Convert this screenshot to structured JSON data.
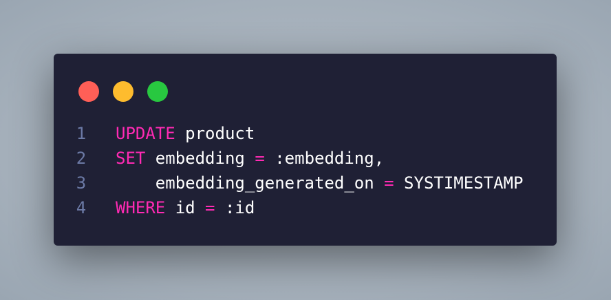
{
  "window_controls": {
    "colors": {
      "close": "#ff5f57",
      "minimize": "#febc2e",
      "maximize": "#28c840"
    }
  },
  "code": {
    "lines": [
      {
        "number": "1",
        "tokens": [
          {
            "t": "UPDATE",
            "k": "kw"
          },
          {
            "t": " product",
            "k": "id"
          }
        ]
      },
      {
        "number": "2",
        "tokens": [
          {
            "t": "SET",
            "k": "kw"
          },
          {
            "t": " embedding ",
            "k": "id"
          },
          {
            "t": "=",
            "k": "op"
          },
          {
            "t": " :embedding,",
            "k": "id"
          }
        ]
      },
      {
        "number": "3",
        "tokens": [
          {
            "t": "    embedding_generated_on ",
            "k": "id"
          },
          {
            "t": "=",
            "k": "op"
          },
          {
            "t": " SYSTIMESTAMP",
            "k": "id"
          }
        ]
      },
      {
        "number": "4",
        "tokens": [
          {
            "t": "WHERE",
            "k": "kw"
          },
          {
            "t": " id ",
            "k": "id"
          },
          {
            "t": "=",
            "k": "op"
          },
          {
            "t": " :id",
            "k": "id"
          }
        ]
      }
    ]
  }
}
